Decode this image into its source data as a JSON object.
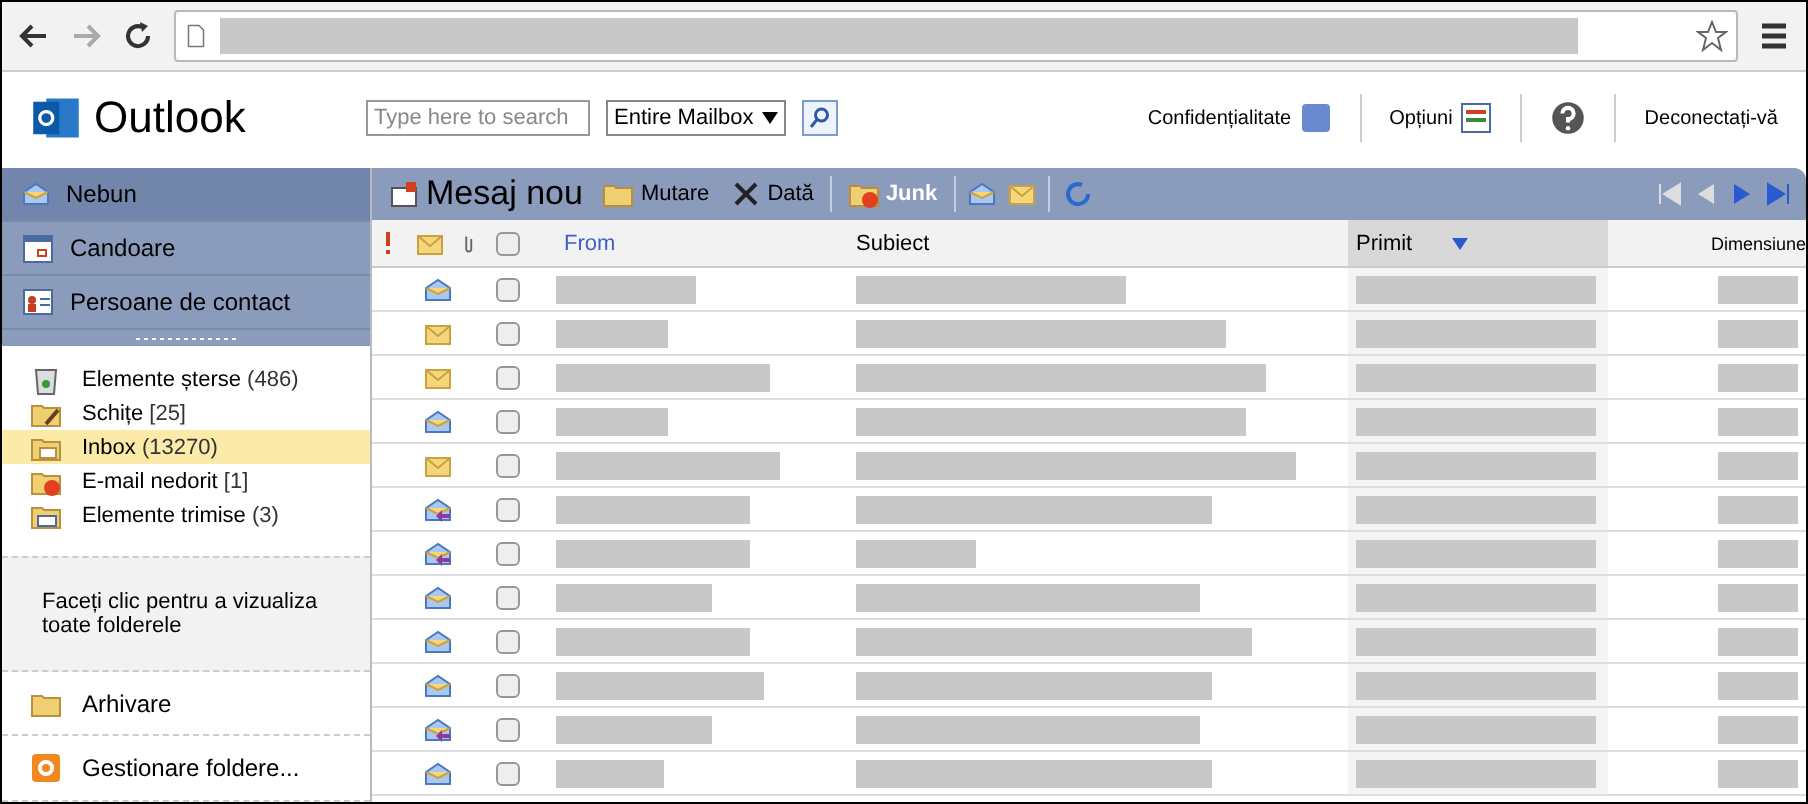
{
  "header": {
    "app_name": "Outlook",
    "search": {
      "placeholder": "Type here to search"
    },
    "scope": {
      "value": "Entire Mailbox"
    },
    "links": [
      {
        "kind": "privacy",
        "label": "Confidențialitate"
      },
      {
        "kind": "options",
        "label": "Opțiuni"
      },
      {
        "kind": "help"
      },
      {
        "kind": "signout",
        "label": "Deconectați-vă"
      }
    ]
  },
  "sidebar": {
    "nav": [
      {
        "kind": "mail",
        "label": "Nebun",
        "selected": true
      },
      {
        "kind": "calendar",
        "label": "Candoare",
        "selected": false
      },
      {
        "kind": "contacts",
        "label": "Persoane de contact",
        "selected": false
      }
    ],
    "folders": [
      {
        "kind": "deleted",
        "label": "Elemente șterse",
        "count": "(486)",
        "selected": false
      },
      {
        "kind": "drafts",
        "label": "Schițe",
        "count": "[25]",
        "selected": false
      },
      {
        "kind": "inbox",
        "label": "Inbox",
        "count": "(13270)",
        "selected": true
      },
      {
        "kind": "junk",
        "label": "E-mail nedorit",
        "count": "[1]",
        "selected": false
      },
      {
        "kind": "sent",
        "label": "Elemente trimise",
        "count": "(3)",
        "selected": false
      }
    ],
    "all_folders_link": "Faceți clic pentru a vizualiza toate folderele",
    "extra": [
      {
        "kind": "archive",
        "label": "Arhivare"
      },
      {
        "kind": "manage",
        "label": "Gestionare foldere..."
      }
    ]
  },
  "toolbar": {
    "new_message": "Mesaj nou",
    "buttons": [
      {
        "kind": "move",
        "label": "Mutare"
      },
      {
        "kind": "delete",
        "label": "Dată"
      },
      {
        "kind": "junk",
        "label": "Junk"
      }
    ]
  },
  "table": {
    "select_all_checked": false,
    "columns": [
      {
        "label": "From",
        "sorted": false
      },
      {
        "label": "Subiect",
        "sorted": false
      },
      {
        "label": "Primit",
        "sorted": true
      },
      {
        "label": "Dimensiune",
        "sorted": false
      }
    ],
    "rows": [
      {
        "kind": "read",
        "checked": false
      },
      {
        "kind": "unread",
        "checked": false
      },
      {
        "kind": "unread",
        "checked": false
      },
      {
        "kind": "read",
        "checked": false
      },
      {
        "kind": "unread",
        "checked": false
      },
      {
        "kind": "replied",
        "checked": false
      },
      {
        "kind": "replied",
        "checked": false
      },
      {
        "kind": "read",
        "checked": false
      },
      {
        "kind": "read",
        "checked": false
      },
      {
        "kind": "read",
        "checked": false
      },
      {
        "kind": "replied",
        "checked": false
      },
      {
        "kind": "read",
        "checked": false
      }
    ]
  }
}
